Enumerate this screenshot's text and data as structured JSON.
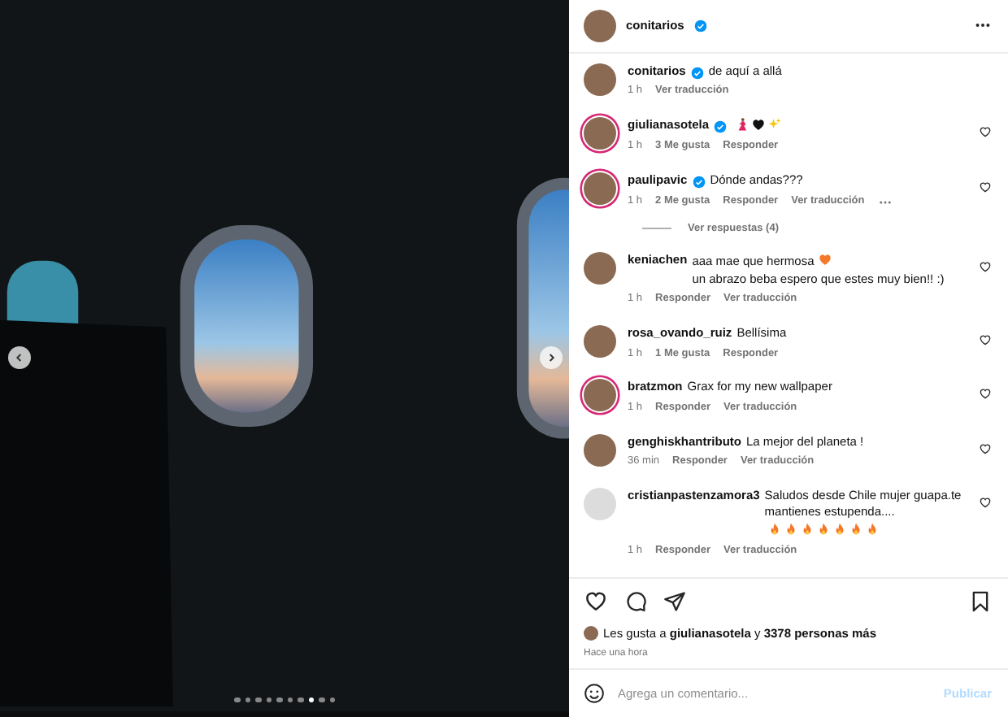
{
  "photo": {
    "slides": [
      {
        "selected": false
      },
      {
        "selected": false
      },
      {
        "selected": false
      },
      {
        "selected": false
      },
      {
        "selected": false
      },
      {
        "selected": false
      },
      {
        "selected": false
      },
      {
        "selected": true
      },
      {
        "selected": false
      },
      {
        "selected": false
      }
    ]
  },
  "header": {
    "user": "conitarios",
    "verified": true
  },
  "comments": [
    {
      "kind": "caption",
      "user": "conitarios",
      "verified": true,
      "ring": false,
      "text": "de aquí a allá",
      "meta": [
        "1 h",
        "Ver traducción"
      ],
      "more": false
    },
    {
      "kind": "comment",
      "user": "giulianasotela",
      "verified": true,
      "ring": true,
      "icons": [
        {
          "kind": "dancer",
          "color": "#e0245e"
        },
        {
          "kind": "heart",
          "color": "#111111"
        },
        {
          "kind": "sparkles",
          "color": "#f5c518"
        }
      ],
      "meta": [
        "1 h",
        "3 Me gusta",
        "Responder"
      ],
      "more": false
    },
    {
      "kind": "comment",
      "user": "paulipavic",
      "verified": true,
      "ring": true,
      "text": "Dónde andas???",
      "meta": [
        "1 h",
        "2 Me gusta",
        "Responder",
        "Ver traducción"
      ],
      "more": true
    },
    {
      "kind": "replies",
      "text": "Ver respuestas (4)"
    },
    {
      "kind": "comment",
      "user": "keniachen",
      "verified": false,
      "ring": false,
      "text": "aaa mae que hermosa",
      "icons": [
        {
          "kind": "heart",
          "color": "#f4782a"
        }
      ],
      "text_after": "un abrazo beba espero que estes muy bien!! :)",
      "meta": [
        "1 h",
        "Responder",
        "Ver traducción"
      ],
      "more": false
    },
    {
      "kind": "comment",
      "user": "rosa_ovando_ruiz",
      "verified": false,
      "ring": false,
      "text": "Bellísima",
      "meta": [
        "1 h",
        "1 Me gusta",
        "Responder"
      ],
      "more": false
    },
    {
      "kind": "comment",
      "user": "bratzmon",
      "verified": false,
      "ring": true,
      "text": "Grax for my new wallpaper",
      "meta": [
        "1 h",
        "Responder",
        "Ver traducción"
      ],
      "more": false
    },
    {
      "kind": "comment",
      "user": "genghiskhantributo",
      "verified": false,
      "ring": false,
      "text": "La mejor del planeta !",
      "meta": [
        "36 min",
        "Responder",
        "Ver traducción"
      ],
      "more": false
    },
    {
      "kind": "comment",
      "user": "cristianpastenzamora3",
      "verified": false,
      "ring": false,
      "text": "Saludos desde Chile mujer guapa.te mantienes estupenda....",
      "icons": [
        {
          "kind": "flame",
          "color": "#f4782a"
        },
        {
          "kind": "flame",
          "color": "#f4782a"
        },
        {
          "kind": "flame",
          "color": "#f4782a"
        },
        {
          "kind": "flame",
          "color": "#f4782a"
        },
        {
          "kind": "flame",
          "color": "#f4782a"
        },
        {
          "kind": "flame",
          "color": "#f4782a"
        },
        {
          "kind": "flame",
          "color": "#f4782a"
        }
      ],
      "meta": [
        "1 h",
        "Responder",
        "Ver traducción"
      ],
      "more": false
    }
  ],
  "likes": {
    "prefix": "Les gusta a",
    "user": "giulianasotela",
    "joiner": "y",
    "others": "3378 personas más"
  },
  "time": "Hace una hora",
  "comment_field": {
    "placeholder": "Agrega un comentario...",
    "button": "Publicar",
    "disabled": true
  }
}
